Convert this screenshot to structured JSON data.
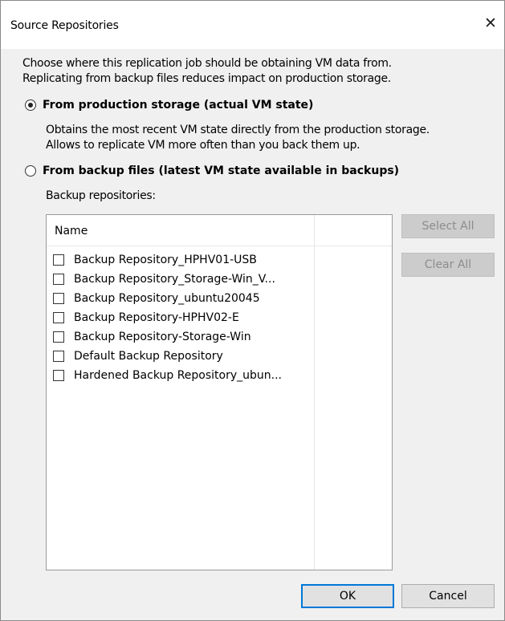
{
  "window": {
    "title": "Source Repositories",
    "close_glyph": "✕"
  },
  "intro": {
    "line1": "Choose where this replication job should be obtaining VM data from.",
    "line2": "Replicating from backup files reduces impact on production storage."
  },
  "options": {
    "production": {
      "label": "From production storage (actual VM state)",
      "selected": true,
      "desc1": "Obtains the most recent VM state directly from the production storage.",
      "desc2": "Allows to replicate VM more often than you back them up."
    },
    "backup": {
      "label": "From backup files (latest VM state available in backups)",
      "selected": false
    }
  },
  "repositories": {
    "label": "Backup repositories:",
    "column_name": "Name",
    "items": [
      {
        "name": "Backup Repository_HPHV01-USB",
        "checked": false
      },
      {
        "name": "Backup Repository_Storage-Win_V...",
        "checked": false
      },
      {
        "name": "Backup Repository_ubuntu20045",
        "checked": false
      },
      {
        "name": "Backup Repository-HPHV02-E",
        "checked": false
      },
      {
        "name": "Backup Repository-Storage-Win",
        "checked": false
      },
      {
        "name": "Default Backup Repository",
        "checked": false
      },
      {
        "name": "Hardened Backup Repository_ubun...",
        "checked": false
      }
    ]
  },
  "buttons": {
    "select_all": "Select All",
    "clear_all": "Clear All",
    "ok": "OK",
    "cancel": "Cancel"
  },
  "colors": {
    "dialog_bg": "#f0f0f0",
    "focus": "#0078d7"
  }
}
